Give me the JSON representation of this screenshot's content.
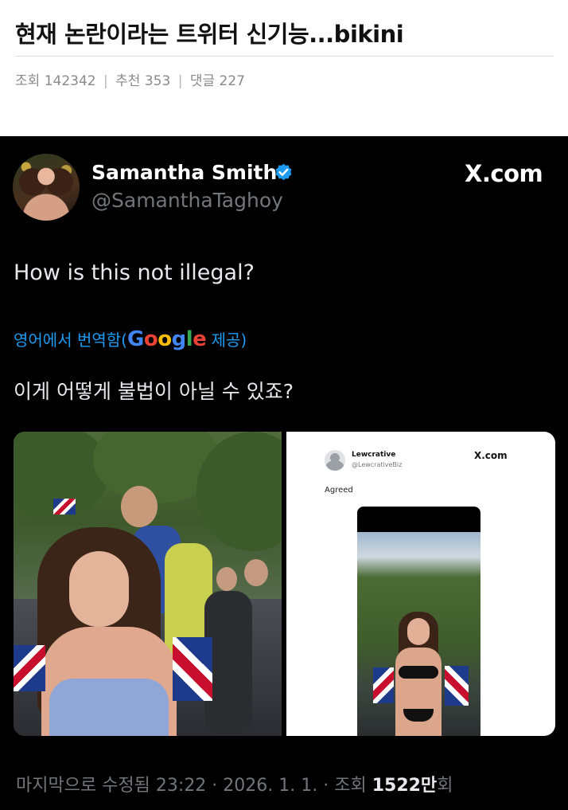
{
  "post": {
    "title": "현재 논란이라는 트위터 신기능...bikini",
    "views_label": "조회",
    "views": "142342",
    "recommend_label": "추천",
    "recommend": "353",
    "comments_label": "댓글",
    "comments": "227",
    "separator": "|"
  },
  "tweet": {
    "display_name": "Samantha Smith",
    "handle": "@SamanthaTaghoy",
    "brand": "X.com",
    "text": "How is this not illegal?",
    "translate_prefix": "영어에서 번역함(",
    "translate_google": [
      "G",
      "o",
      "o",
      "g",
      "l",
      "e"
    ],
    "translate_suffix": " 제공)",
    "translated_text": "이게 어떻게 불법이 아닐 수 있죠?",
    "verified_color": "#1d9bf0",
    "footer": {
      "edited": "마지막으로 수정됨 23:22 · 2026. 1. 1.",
      "views_prefix": " · 조회 ",
      "views_num": "1522만",
      "views_suffix": "회"
    }
  },
  "embedded_tweet": {
    "name": "Lewcrative",
    "handle": "@LewcrativeBiz",
    "brand": "X.com",
    "text": "Agreed"
  },
  "icons": [
    "verified-badge-icon",
    "default-avatar-icon"
  ]
}
